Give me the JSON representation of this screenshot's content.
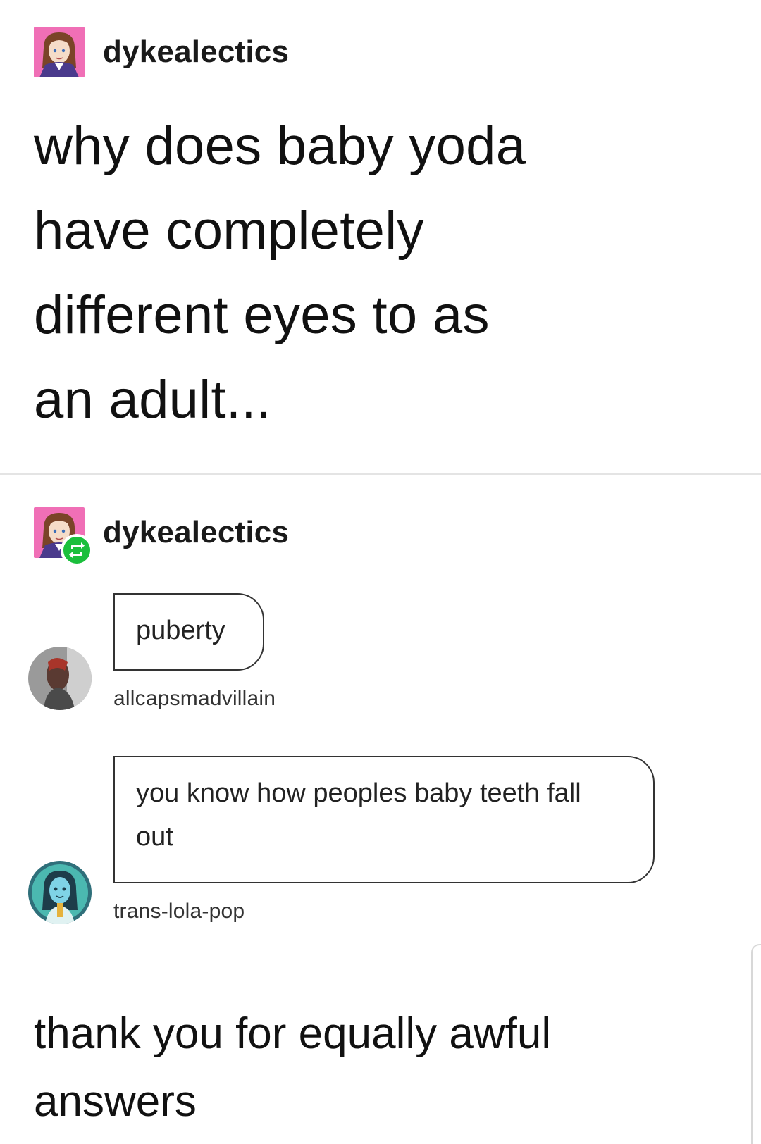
{
  "post": {
    "username": "dykealectics",
    "body_lines": [
      "why does baby yoda",
      "have completely",
      "different eyes to as",
      "an adult..."
    ]
  },
  "reblog": {
    "username": "dykealectics"
  },
  "replies": [
    {
      "text": "puberty",
      "username": "allcapsmadvillain"
    },
    {
      "text_lines": [
        "you know how peoples baby teeth fall",
        "out"
      ],
      "username": "trans-lola-pop"
    }
  ],
  "closing": {
    "lines": [
      "thank you for equally awful",
      "answers"
    ]
  },
  "icons": {
    "reblog_badge": "reblog-icon"
  },
  "colors": {
    "reblog_green": "#1bbf3c",
    "avatar_pink": "#f06fb6",
    "text": "#111111"
  }
}
